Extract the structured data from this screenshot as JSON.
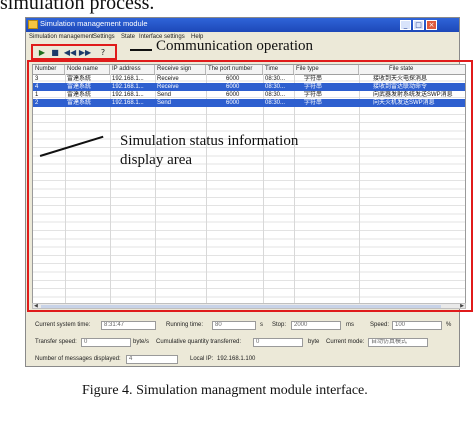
{
  "top_text": "simulation process.",
  "window": {
    "title": "Simulation management module"
  },
  "menu": [
    "Simulation management",
    "Settings",
    "State",
    "Interface settings",
    "Help"
  ],
  "toolbar": {
    "play": "▶",
    "stop": "■",
    "rewind": "◀◀",
    "forward": "▶▶",
    "help": "?"
  },
  "annotations": {
    "communication": "Communication operation",
    "status_line1": "Simulation status information",
    "status_line2": "display area"
  },
  "table": {
    "headers": [
      "Number",
      "Node name",
      "IP address",
      "Receive sign",
      "The port number",
      "Time",
      "File type",
      "File state"
    ],
    "rows": [
      {
        "selected": false,
        "cells": [
          "3",
          "雷達系統",
          "192.168.1...",
          "Receive",
          "6000",
          "08:30...",
          "字符串",
          "接收到天火电探消息"
        ]
      },
      {
        "selected": true,
        "cells": [
          "4",
          "雷達系統",
          "192.168.1...",
          "Receive",
          "6000",
          "08:30...",
          "字符串",
          "接收到雷达联动命令"
        ]
      },
      {
        "selected": false,
        "cells": [
          "1",
          "雷達系統",
          "192.168.1...",
          "Send",
          "6000",
          "08:30...",
          "字符串",
          "向武器发射系统发送SWP消息"
        ]
      },
      {
        "selected": true,
        "cells": [
          "2",
          "雷達系統",
          "192.168.1...",
          "Send",
          "6000",
          "08:30...",
          "字符串",
          "向天火机发送SWP消息"
        ]
      }
    ]
  },
  "status": {
    "current_time_label": "Current system time:",
    "current_time": "8:31:47",
    "running_time_label": "Running time:",
    "running_time": "80",
    "running_unit": "s",
    "stop_label": "Stop:",
    "stop_value": "2000",
    "stop_unit": "ms",
    "speed_label": "Speed:",
    "speed_value": "100",
    "speed_unit": "%",
    "transfer_label": "Transfer speed:",
    "transfer_value": "0",
    "transfer_unit": "byte/s",
    "cumulative_label": "Cumulative quantity transferred:",
    "cumulative_value": "0",
    "cumulative_unit": "byte",
    "mode_label": "Current mode:",
    "mode_value": "自动仿真模式",
    "messages_label": "Number of messages displayed:",
    "messages_value": "4",
    "localip_label": "Local IP:",
    "localip_value": "192.168.1.100"
  },
  "caption": {
    "prefix": "Figure 4.",
    "text": "Simulation managment module interface."
  }
}
